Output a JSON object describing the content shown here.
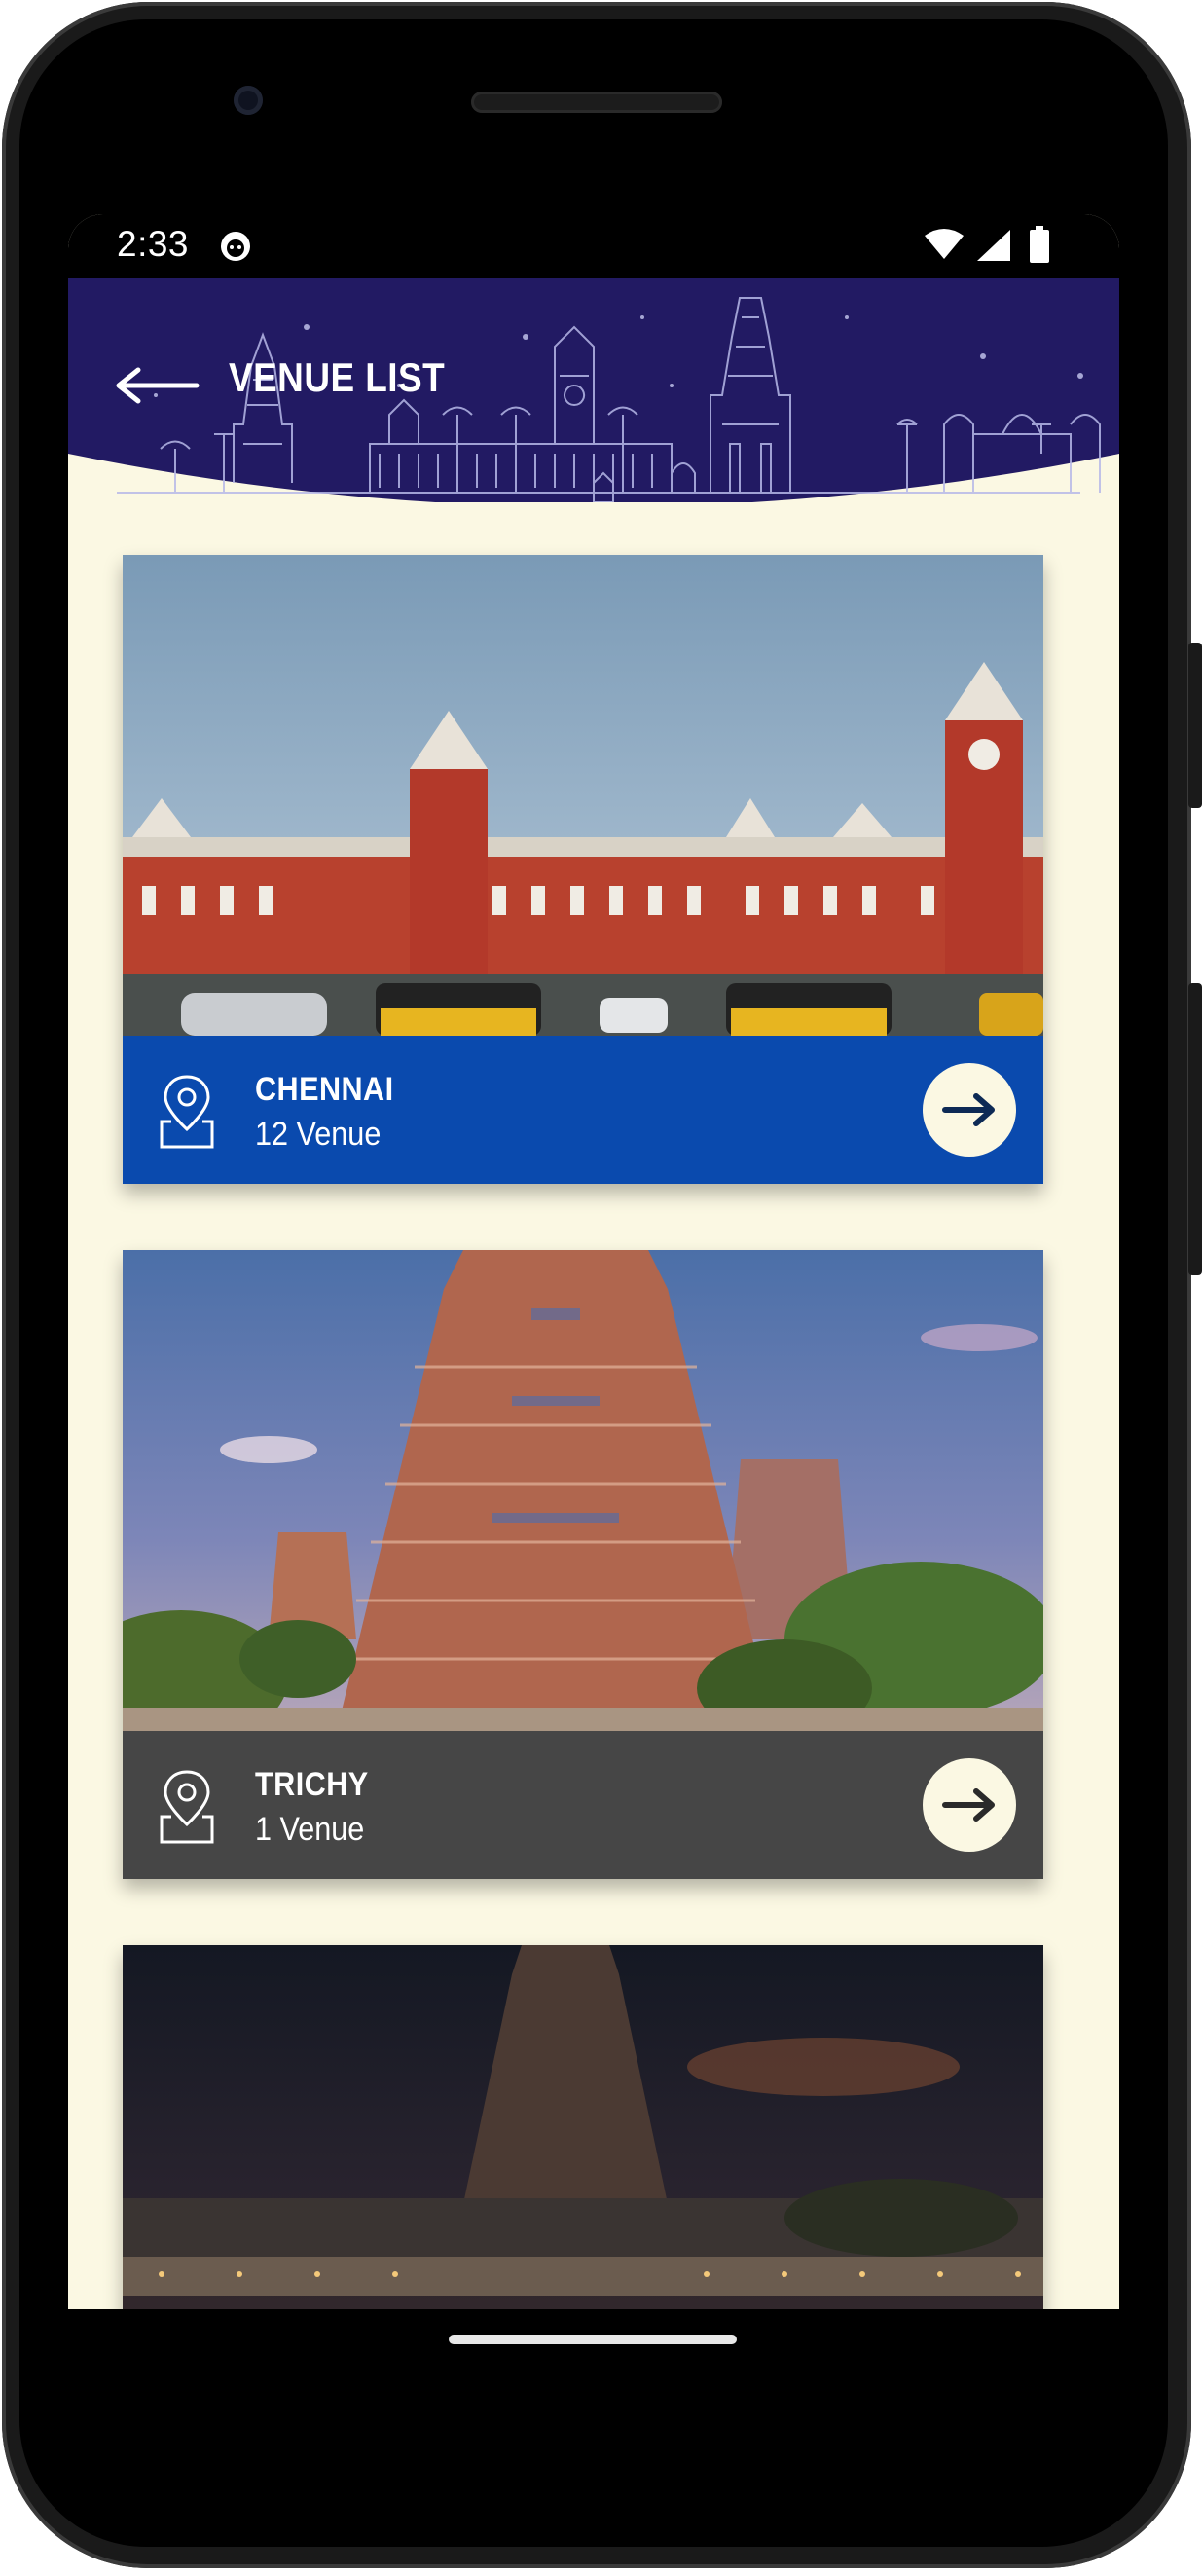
{
  "status_bar": {
    "time": "2:33"
  },
  "header": {
    "title": "VENUE LIST"
  },
  "colors": {
    "header_bg": "#221a63",
    "screen_bg": "#fbf8e3",
    "chennai_bar": "#0a4aae",
    "trichy_bar": "#464646"
  },
  "venues": [
    {
      "city": "CHENNAI",
      "count": "12 Venue"
    },
    {
      "city": "TRICHY",
      "count": "1 Venue"
    },
    {
      "city": "",
      "count": ""
    }
  ]
}
